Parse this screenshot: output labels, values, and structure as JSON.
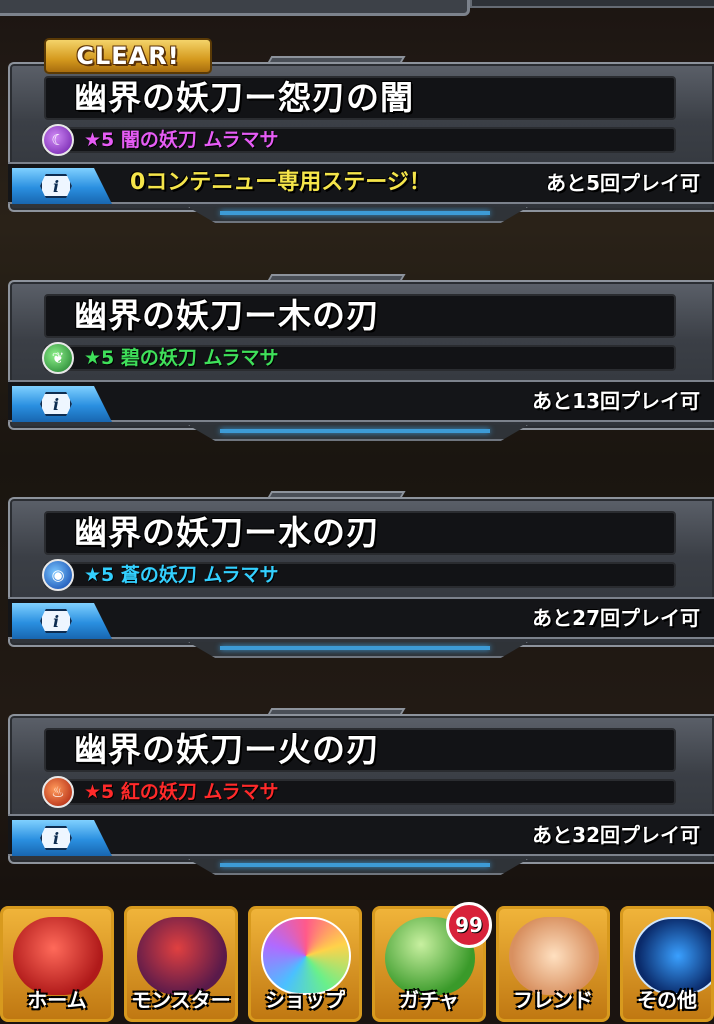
{
  "stages": [
    {
      "cleared": true,
      "clear_label": "CLEAR!",
      "title": "幽界の妖刀ー怨刃の闇",
      "element": "dark",
      "element_color": "#b04ae8",
      "monster": "★5 闇の妖刀 ムラマサ",
      "monster_color": "#e65cf5",
      "notice": "0コンテニュー専用ステージ！",
      "plays": "あと5回プレイ可"
    },
    {
      "cleared": false,
      "title": "幽界の妖刀ー木の刃",
      "element": "wood",
      "element_color": "#2ea84a",
      "monster": "★5 碧の妖刀 ムラマサ",
      "monster_color": "#3fe05a",
      "notice": "",
      "plays": "あと13回プレイ可"
    },
    {
      "cleared": false,
      "title": "幽界の妖刀ー水の刃",
      "element": "water",
      "element_color": "#1f6fe0",
      "monster": "★5 蒼の妖刀 ムラマサ",
      "monster_color": "#33d0ff",
      "notice": "",
      "plays": "あと27回プレイ可"
    },
    {
      "cleared": false,
      "title": "幽界の妖刀ー火の刃",
      "element": "fire",
      "element_color": "#e0401c",
      "monster": "★5 紅の妖刀 ムラマサ",
      "monster_color": "#ff2a2a",
      "notice": "",
      "plays": "あと32回プレイ可"
    }
  ],
  "info_icon": "info-icon",
  "nav": {
    "items": [
      {
        "label": "ホーム",
        "icon": "home-monster-icon",
        "color": "#d82a2a"
      },
      {
        "label": "モンスター",
        "icon": "monster-dragon-icon",
        "color": "#b81e2e"
      },
      {
        "label": "ショップ",
        "icon": "rainbow-orb-icon",
        "color": "#7ad0ff"
      },
      {
        "label": "ガチャ",
        "icon": "egg-icon",
        "color": "#5fc04a"
      },
      {
        "label": "フレンド",
        "icon": "handshake-icon",
        "color": "#f3c9a0"
      },
      {
        "label": "その他",
        "icon": "radar-icon",
        "color": "#1e7fd8"
      }
    ],
    "gacha_badge": "99"
  }
}
